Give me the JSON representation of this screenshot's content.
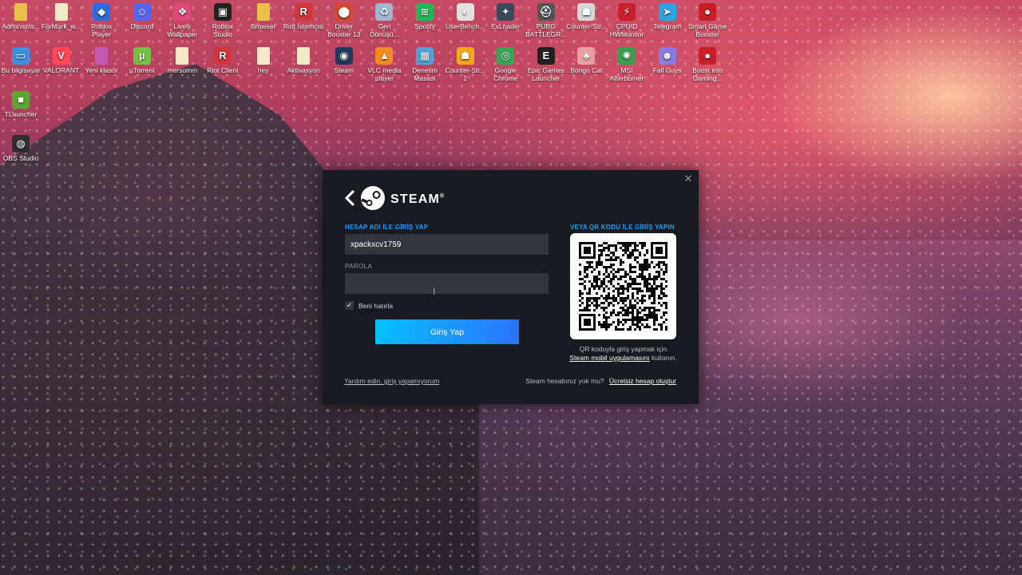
{
  "desktop": {
    "icons": [
      {
        "label": "Administra...",
        "icon": "user-folder-icon",
        "color": "#e8c14a"
      },
      {
        "label": "FurMark_w...",
        "icon": "file-icon",
        "color": "#f3e9c6"
      },
      {
        "label": "Roblox Player",
        "icon": "roblox-icon",
        "color": "#2d6cdf"
      },
      {
        "label": "Discord",
        "icon": "discord-icon",
        "color": "#5865f2"
      },
      {
        "label": "Lively Wallpaper",
        "icon": "lively-icon",
        "color": "#e04a7a"
      },
      {
        "label": "Roblox Studio",
        "icon": "roblox-studio-icon",
        "color": "#222222"
      },
      {
        "label": "Browser",
        "icon": "folder-icon",
        "color": "#e8c14a"
      },
      {
        "label": "Riot İstemcisi",
        "icon": "riot-icon",
        "color": "#d13639"
      },
      {
        "label": "Driver Booster 13",
        "icon": "driver-booster-icon",
        "color": "#d34a2a"
      },
      {
        "label": "Geri Dönüşü...",
        "icon": "recycle-bin-icon",
        "color": "#9fb8d0"
      },
      {
        "label": "Spotify",
        "icon": "spotify-icon",
        "color": "#1db954"
      },
      {
        "label": "UserBench...",
        "icon": "userbench-icon",
        "color": "#e0e0e0"
      },
      {
        "label": "ExLoader",
        "icon": "exloader-icon",
        "color": "#3a4a5a"
      },
      {
        "label": "PUBG BATTLEGR...",
        "icon": "pubg-icon",
        "color": "#555555"
      },
      {
        "label": "Counter-Str...",
        "icon": "counter-strike-icon",
        "color": "#d8d8d8"
      },
      {
        "label": "CPUID HWMonitor",
        "icon": "hwmonitor-icon",
        "color": "#c8202a"
      },
      {
        "label": "Telegram",
        "icon": "telegram-icon",
        "color": "#2aa3e0"
      },
      {
        "label": "Smart Game Booster",
        "icon": "game-booster-icon",
        "color": "#c81e28"
      },
      {
        "label": "Bu bilgisayar",
        "icon": "computer-icon",
        "color": "#3d8fe0"
      },
      {
        "label": "VALORANT",
        "icon": "valorant-icon",
        "color": "#ff4655"
      },
      {
        "label": "Yeni klasör",
        "icon": "folder-icon",
        "color": "#c45bb0"
      },
      {
        "label": "µTorrent",
        "icon": "utorrent-icon",
        "color": "#78c043"
      },
      {
        "label": "mersomm",
        "icon": "file-icon",
        "color": "#f3e9c6"
      },
      {
        "label": "Riot Client",
        "icon": "riot-client-icon",
        "color": "#d13639"
      },
      {
        "label": "hey",
        "icon": "file-icon",
        "color": "#f3e9c6"
      },
      {
        "label": "Aktivasyon",
        "icon": "file-icon",
        "color": "#f3e9c6"
      },
      {
        "label": "Steam",
        "icon": "steam-icon",
        "color": "#1b3a5c"
      },
      {
        "label": "VLC media player",
        "icon": "vlc-icon",
        "color": "#f28a1d"
      },
      {
        "label": "Denetim Masası",
        "icon": "control-panel-icon",
        "color": "#4fa3d8"
      },
      {
        "label": "Counter-Str... 2",
        "icon": "counter-strike-2-icon",
        "color": "#f2a71d"
      },
      {
        "label": "Google Chrome",
        "icon": "chrome-icon",
        "color": "#34a853"
      },
      {
        "label": "Epic Games Launcher",
        "icon": "epic-games-icon",
        "color": "#222222"
      },
      {
        "label": "Bongo Cat",
        "icon": "bongo-cat-icon",
        "color": "#e8a0a0"
      },
      {
        "label": "MSI Afterburner",
        "icon": "afterburner-icon",
        "color": "#3aa04a"
      },
      {
        "label": "Fall Guys",
        "icon": "fall-guys-icon",
        "color": "#8a7ae0"
      },
      {
        "label": "Boost into Gaming...",
        "icon": "boost-icon",
        "color": "#c81e28"
      },
      {
        "label": "TLauncher",
        "icon": "tlauncher-icon",
        "color": "#5aa830"
      },
      {
        "label": "OBS Studio",
        "icon": "obs-icon",
        "color": "#302e31"
      }
    ]
  },
  "steam_dialog": {
    "brand": "STEAM",
    "brand_mark": "®",
    "close_glyph": "✕",
    "back_glyph": "‹",
    "account_label": "HESAP ADI İLE GİRİŞ YAP",
    "account_value": "xpackxcv1759",
    "password_label": "PAROLA",
    "password_value": "",
    "remember_label": "Beni hatırla",
    "remember_checked": true,
    "login_button": "Giriş Yap",
    "help_link": "Yardım edin, giriş yapamıyorum",
    "qr_title": "VEYA QR KODU İLE GİRİŞ YAPIN",
    "qr_caption_line1": "QR koduyla giriş yapmak için",
    "qr_caption_link": "Steam mobil uygulamasını",
    "qr_caption_end": "kullanın.",
    "no_account_text": "Steam hesabınız yok mu?",
    "create_account_link": "Ücretsiz hesap oluştur",
    "accent_color": "#1a9fff",
    "button_gradient": [
      "#06bfff",
      "#2d73ff"
    ]
  }
}
